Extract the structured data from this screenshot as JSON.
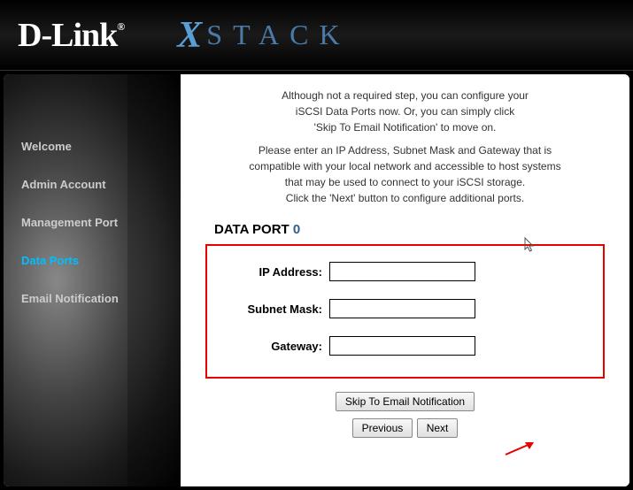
{
  "header": {
    "brand": "D-Link",
    "brand_reg": "®",
    "product_x": "X",
    "product_stack": "STACK"
  },
  "sidebar": {
    "items": [
      {
        "label": "Welcome",
        "active": false
      },
      {
        "label": "Admin Account",
        "active": false
      },
      {
        "label": "Management Port",
        "active": false
      },
      {
        "label": "Data Ports",
        "active": true
      },
      {
        "label": "Email Notification",
        "active": false
      }
    ]
  },
  "main": {
    "intro_line1": "Although not a required step, you can configure your",
    "intro_line2": "iSCSI Data Ports now. Or, you can simply click",
    "intro_line3": "'Skip To Email Notification' to move on.",
    "details_line1": "Please enter an IP Address, Subnet Mask and Gateway that is",
    "details_line2": "compatible with your local network and accessible to host systems",
    "details_line3": "that may be used to connect to your iSCSI storage.",
    "details_line4": "Click the 'Next' button to configure additional ports.",
    "section_prefix": "DATA PORT ",
    "port_number": "0",
    "fields": {
      "ip_label": "IP Address:",
      "ip_value": "",
      "subnet_label": "Subnet Mask:",
      "subnet_value": "",
      "gateway_label": "Gateway:",
      "gateway_value": ""
    },
    "buttons": {
      "skip": "Skip To Email Notification",
      "prev": "Previous",
      "next": "Next"
    }
  }
}
